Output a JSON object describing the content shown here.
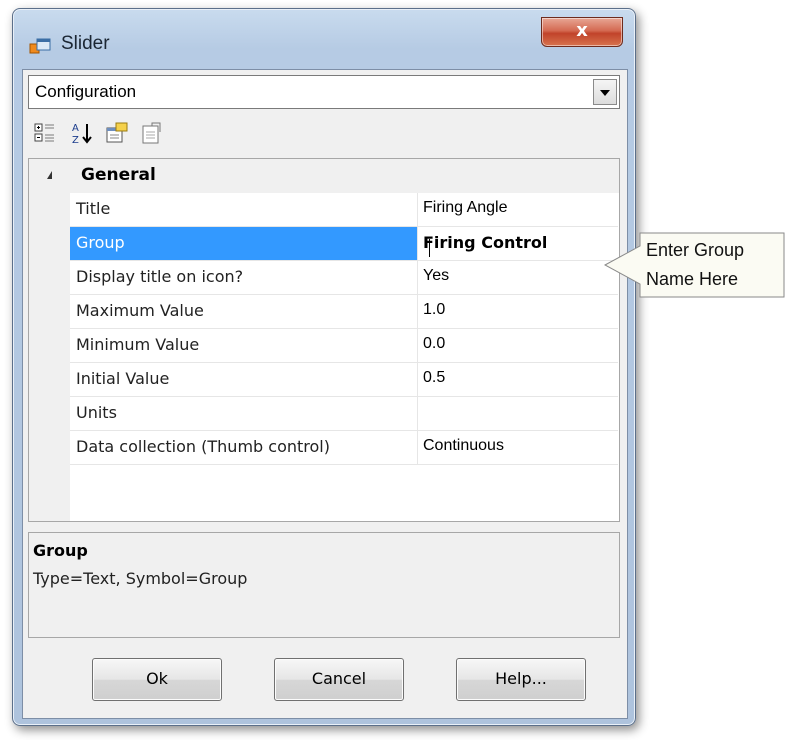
{
  "window": {
    "title": "Slider",
    "close_label": "x",
    "accent_color": "#3399ff"
  },
  "combo": {
    "value": "Configuration"
  },
  "toolbar": {
    "icons": [
      "categorized-icon",
      "alphabetical-sort-icon",
      "property-pages-icon",
      "property-pages-disabled-icon"
    ]
  },
  "grid": {
    "category": "General",
    "rows": [
      {
        "name": "Title",
        "value": "Firing Angle"
      },
      {
        "name": "Group",
        "value": "Firing Control"
      },
      {
        "name": "Display title on icon?",
        "value": "Yes"
      },
      {
        "name": "Maximum Value",
        "value": "1.0"
      },
      {
        "name": "Minimum Value",
        "value": "0.0"
      },
      {
        "name": "Initial Value",
        "value": "0.5"
      },
      {
        "name": "Units",
        "value": ""
      },
      {
        "name": "Data collection (Thumb control)",
        "value": "Continuous"
      }
    ],
    "selected_index": 1
  },
  "description": {
    "title": "Group",
    "text": "Type=Text, Symbol=Group"
  },
  "buttons": {
    "ok": "Ok",
    "cancel": "Cancel",
    "help": "Help..."
  },
  "callout": {
    "line1": "Enter Group",
    "line2": "Name Here"
  }
}
